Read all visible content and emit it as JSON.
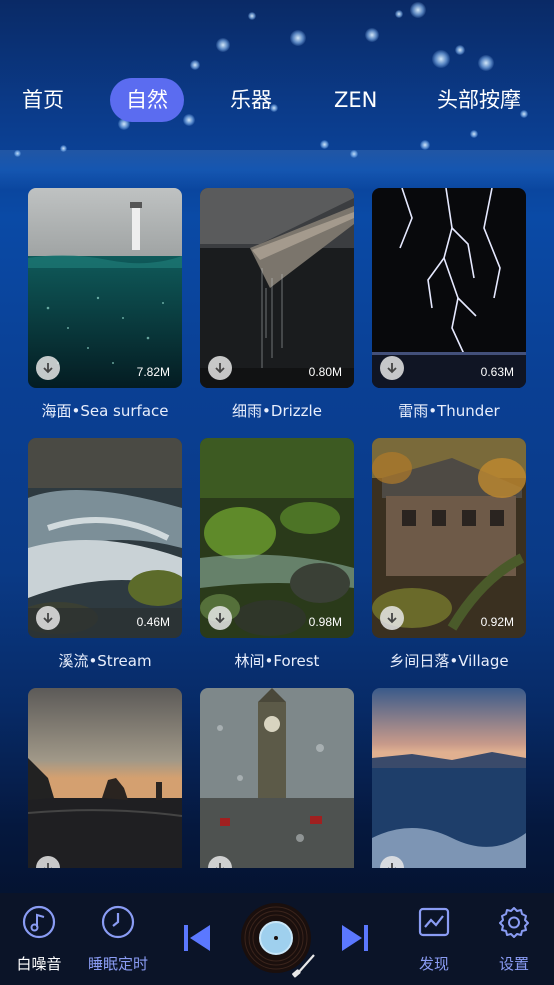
{
  "tabs": [
    {
      "label": "首页",
      "active": false
    },
    {
      "label": "自然",
      "active": true
    },
    {
      "label": "乐器",
      "active": false
    },
    {
      "label": "ZEN",
      "active": false
    },
    {
      "label": "头部按摩",
      "active": false
    }
  ],
  "cards": [
    {
      "title": "海面•Sea surface",
      "size": "7.82M"
    },
    {
      "title": "细雨•Drizzle",
      "size": "0.80M"
    },
    {
      "title": "雷雨•Thunder",
      "size": "0.63M"
    },
    {
      "title": "溪流•Stream",
      "size": "0.46M"
    },
    {
      "title": "林间•Forest",
      "size": "0.98M"
    },
    {
      "title": "乡间日落•Village",
      "size": "0.92M"
    },
    {
      "title": "",
      "size": ""
    },
    {
      "title": "",
      "size": ""
    },
    {
      "title": "",
      "size": ""
    }
  ],
  "bottom_nav": {
    "white_noise": "白噪音",
    "sleep_timer": "睡眠定时",
    "discover": "发现",
    "settings": "设置"
  },
  "colors": {
    "accent": "#5b6cf0",
    "nav_label": "#8a9cf4",
    "bottom_bar": "#0b1428"
  }
}
